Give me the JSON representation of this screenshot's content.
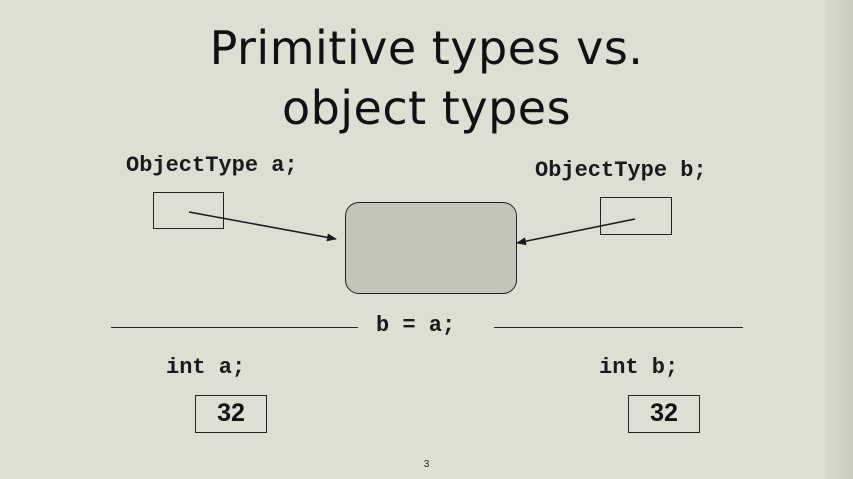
{
  "slide": {
    "title_line1": "Primitive types vs.",
    "title_line2": "object types",
    "left_declaration": "ObjectType a;",
    "right_declaration": "ObjectType b;",
    "assignment": "b = a;",
    "left_int_declaration": "int a;",
    "right_int_declaration": "int b;",
    "left_int_value": "32",
    "right_int_value": "32",
    "page_number": "3"
  },
  "colors": {
    "background": "#dcdfd2",
    "object_fill": "#c6c5ba",
    "ink": "#1a1a1a"
  }
}
